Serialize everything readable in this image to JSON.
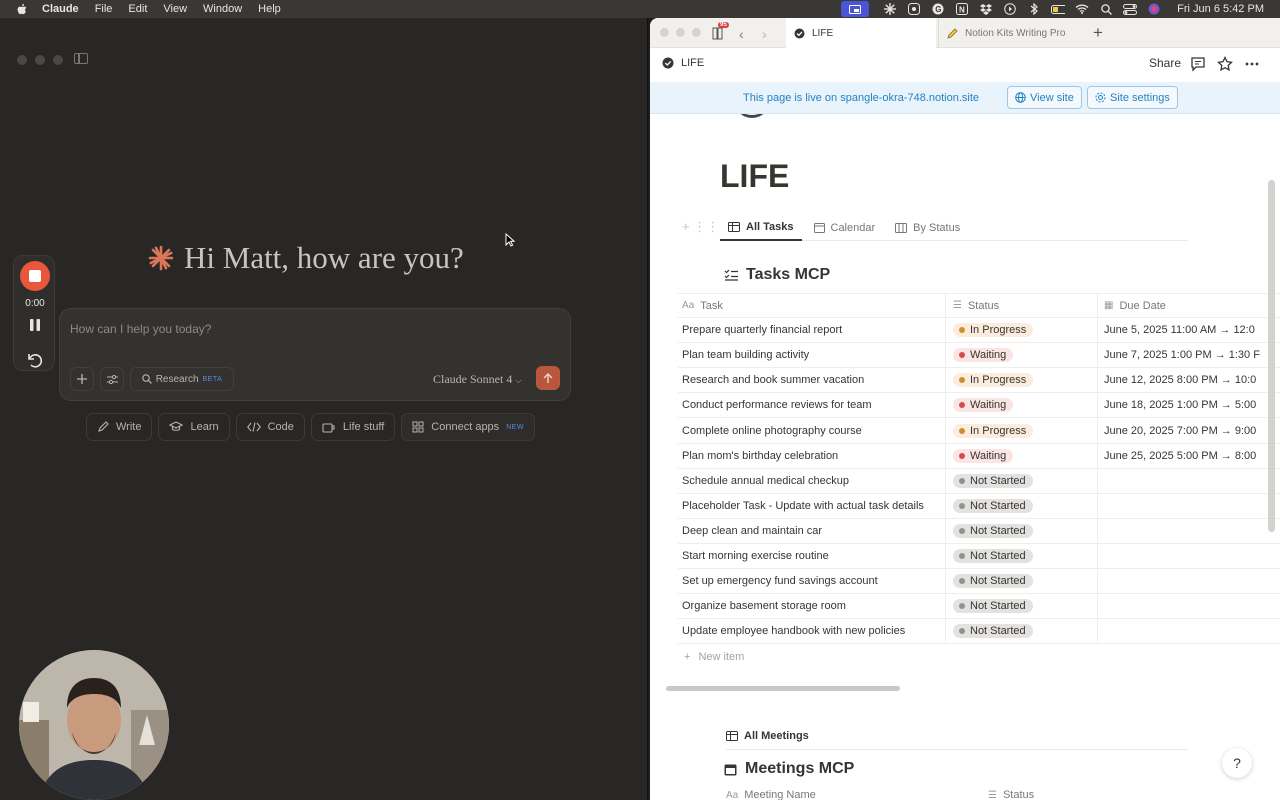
{
  "menubar": {
    "app": "Claude",
    "items": [
      "File",
      "Edit",
      "View",
      "Window",
      "Help"
    ],
    "clock": "Fri Jun 6  5:42 PM"
  },
  "claude": {
    "greeting": "Hi Matt, how are you?",
    "recorder": {
      "time": "0:00"
    },
    "chat": {
      "placeholder": "How can I help you today?",
      "research_label": "Research",
      "beta_badge": "BETA",
      "model": "Claude Sonnet 4"
    },
    "chips": [
      {
        "label": "Write",
        "icon": "pencil-icon"
      },
      {
        "label": "Learn",
        "icon": "graduation-cap-icon"
      },
      {
        "label": "Code",
        "icon": "code-icon"
      },
      {
        "label": "Life stuff",
        "icon": "mug-icon"
      },
      {
        "label": "Connect apps",
        "icon": "grid-icon",
        "badge": "NEW"
      }
    ],
    "accent": "#e8563c"
  },
  "notion": {
    "tabs": {
      "badge": "95",
      "active": "LIFE",
      "inactive": "Notion Kits Writing Pro"
    },
    "pagebar": {
      "title": "LIFE",
      "share": "Share"
    },
    "banner": {
      "text": "This page is live on spangle-okra-748.notion.site",
      "view_site": "View site",
      "site_settings": "Site settings"
    },
    "page_title": "LIFE",
    "views": [
      "All Tasks",
      "Calendar",
      "By Status"
    ],
    "db_title": "Tasks MCP",
    "columns": {
      "task": "Task",
      "status": "Status",
      "due": "Due Date"
    },
    "status_colors": {
      "In Progress": {
        "bg": "#fbecdd",
        "dot": "#cb912f"
      },
      "Waiting": {
        "bg": "#fbe4e4",
        "dot": "#d44c47"
      },
      "Not Started": {
        "bg": "#e3e2e0",
        "dot": "#91918e"
      }
    },
    "rows": [
      {
        "task": "Prepare quarterly financial report",
        "status": "In Progress",
        "due": "June 5, 2025 11:00 AM → 12:0"
      },
      {
        "task": "Plan team building activity",
        "status": "Waiting",
        "due": "June 7, 2025 1:00 PM → 1:30 F"
      },
      {
        "task": "Research and book summer vacation",
        "status": "In Progress",
        "due": "June 12, 2025 8:00 PM → 10:0"
      },
      {
        "task": "Conduct performance reviews for team",
        "status": "Waiting",
        "due": "June 18, 2025 1:00 PM → 5:00"
      },
      {
        "task": "Complete online photography course",
        "status": "In Progress",
        "due": "June 20, 2025 7:00 PM → 9:00"
      },
      {
        "task": "Plan mom's birthday celebration",
        "status": "Waiting",
        "due": "June 25, 2025 5:00 PM → 8:00"
      },
      {
        "task": "Schedule annual medical checkup",
        "status": "Not Started",
        "due": ""
      },
      {
        "task": "Placeholder Task - Update with actual task details",
        "status": "Not Started",
        "due": ""
      },
      {
        "task": "Deep clean and maintain car",
        "status": "Not Started",
        "due": ""
      },
      {
        "task": "Start morning exercise routine",
        "status": "Not Started",
        "due": ""
      },
      {
        "task": "Set up emergency fund savings account",
        "status": "Not Started",
        "due": ""
      },
      {
        "task": "Organize basement storage room",
        "status": "Not Started",
        "due": ""
      },
      {
        "task": "Update employee handbook with new policies",
        "status": "Not Started",
        "due": ""
      }
    ],
    "new_item": "New item",
    "meetings": {
      "view": "All Meetings",
      "title": "Meetings MCP",
      "col_name": "Meeting Name",
      "col_status": "Status"
    }
  }
}
